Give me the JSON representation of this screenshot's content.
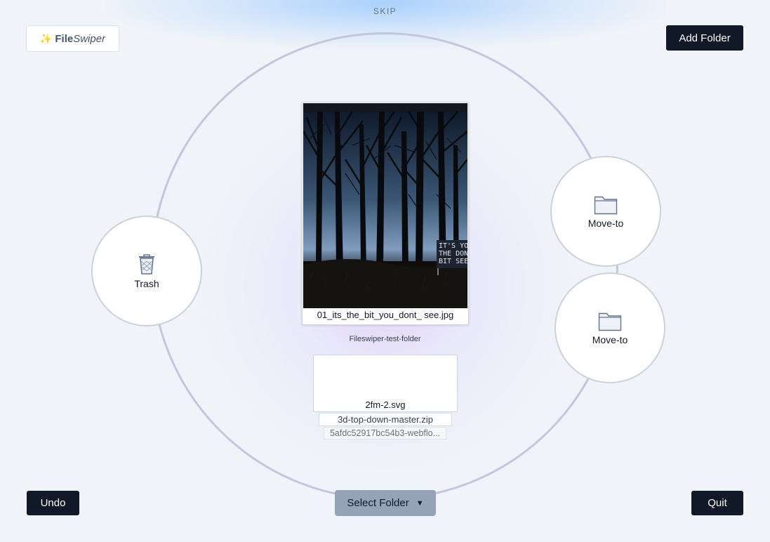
{
  "header": {
    "skip_label": "SKIP"
  },
  "brand": {
    "spark": "✨",
    "part1": "File",
    "part2": "Swiper"
  },
  "buttons": {
    "add_folder": "Add Folder",
    "undo": "Undo",
    "quit": "Quit"
  },
  "actions": {
    "trash_label": "Trash",
    "move1_label": "Move-to",
    "move2_label": "Move-to"
  },
  "current_file": {
    "name": "01_its_the_bit_you_dont_ see.jpg",
    "sign_lines": [
      "IT'S YOU",
      "THE DON'",
      "BIT SEE"
    ]
  },
  "folder": {
    "name": "Fileswiper-test-folder"
  },
  "queue": [
    "2fm-2.svg",
    "3d-top-down-master.zip",
    "5afdc52917bc54b3-webflo..."
  ],
  "select_folder": {
    "label": "Select Folder",
    "arrow": "▼"
  },
  "icons": {
    "trash": "trash-bin-icon",
    "folder": "folder-icon"
  }
}
